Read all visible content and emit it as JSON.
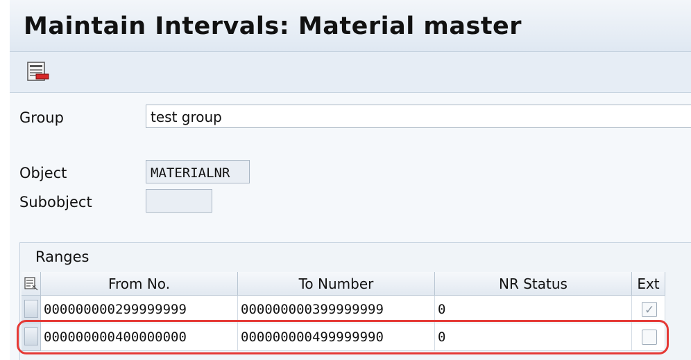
{
  "title": "Maintain Intervals: Material master",
  "toolbar": {
    "save_icon": "save-icon"
  },
  "form": {
    "group_label": "Group",
    "group_value": "test group",
    "object_label": "Object",
    "object_value": "MATERIALNR",
    "subobject_label": "Subobject",
    "subobject_value": ""
  },
  "ranges": {
    "title": "Ranges",
    "columns": [
      "From No.",
      "To Number",
      "NR Status",
      "Ext"
    ],
    "rows": [
      {
        "from": "000000000299999999",
        "to": "000000000399999999",
        "status": "0",
        "ext": true
      },
      {
        "from": "000000000400000000",
        "to": "000000000499999990",
        "status": "0",
        "ext": false
      }
    ]
  },
  "colors": {
    "highlight": "#e53935"
  }
}
